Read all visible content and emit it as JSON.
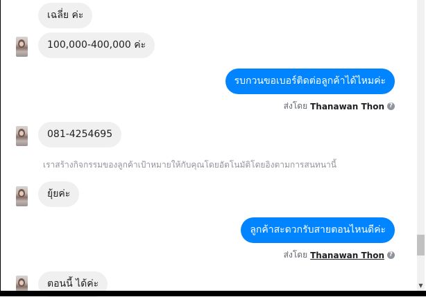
{
  "messages": {
    "m1": {
      "text": "เฉลี่ย ค่ะ"
    },
    "m2": {
      "text": "100,000-400,000 ค่ะ"
    },
    "m3": {
      "text": "รบกวนขอเบอร์ติดต่อลูกค้าได้ไหมค่ะ",
      "sent_by_prefix": "ส่งโดย",
      "sent_by_name": "Thanawan Thon"
    },
    "m4": {
      "text": "081-4254695"
    },
    "system_note": "เราสร้างกิจกรรมของลูกค้าเป้าหมายให้กับคุณโดยอัตโนมัติโดยอิงตามการสนทนานี้",
    "m5": {
      "text": "ยุ้ยค่ะ"
    },
    "m6": {
      "text": "ลูกค้าสะดวกรับสายตอนไหนดีค่ะ",
      "sent_by_prefix": "ส่งโดย",
      "sent_by_name": "Thanawan Thon"
    },
    "m7": {
      "text": "ตอนนี้ ได้ค่ะ"
    }
  },
  "icons": {
    "help": "question-circle-icon",
    "avatar": "contact-avatar"
  },
  "colors": {
    "outgoing_bubble": "#0084ff",
    "incoming_bubble": "#f0f0f0",
    "muted_text": "#90949c"
  }
}
